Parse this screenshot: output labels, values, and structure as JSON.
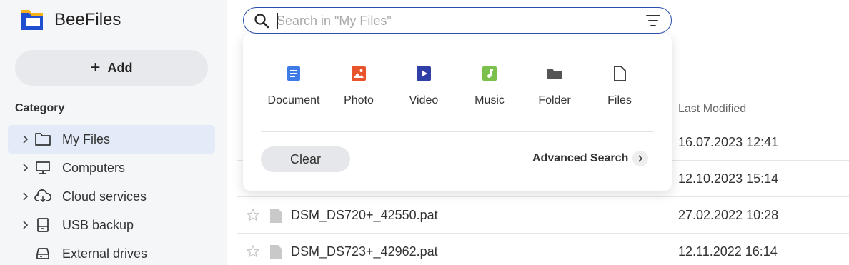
{
  "app": {
    "name": "BeeFiles"
  },
  "sidebar": {
    "add_label": "Add",
    "category_label": "Category",
    "items": [
      {
        "label": "My Files",
        "icon": "folder-icon",
        "active": true,
        "expandable": true
      },
      {
        "label": "Computers",
        "icon": "monitor-icon",
        "active": false,
        "expandable": true
      },
      {
        "label": "Cloud services",
        "icon": "cloud-sync-icon",
        "active": false,
        "expandable": true
      },
      {
        "label": "USB backup",
        "icon": "usb-drive-icon",
        "active": false,
        "expandable": true
      },
      {
        "label": "External drives",
        "icon": "external-drive-icon",
        "active": false,
        "expandable": false
      }
    ]
  },
  "search": {
    "placeholder": "Search in \"My Files\"",
    "value": ""
  },
  "popover": {
    "types": [
      {
        "label": "Document",
        "icon": "document-icon",
        "color": "#3d7be6"
      },
      {
        "label": "Photo",
        "icon": "photo-icon",
        "color": "#e8542c"
      },
      {
        "label": "Video",
        "icon": "video-icon",
        "color": "#2f3fa6"
      },
      {
        "label": "Music",
        "icon": "music-icon",
        "color": "#7cc04c"
      },
      {
        "label": "Folder",
        "icon": "folder-icon",
        "color": "#555555"
      },
      {
        "label": "Files",
        "icon": "file-icon",
        "color": "#555555"
      }
    ],
    "clear_label": "Clear",
    "advanced_label": "Advanced Search"
  },
  "list": {
    "header_modified": "Last Modified",
    "rows": [
      {
        "name": "",
        "modified": "16.07.2023 12:41"
      },
      {
        "name": "",
        "modified": "12.10.2023 15:14"
      },
      {
        "name": "DSM_DS720+_42550.pat",
        "modified": "27.02.2022 10:28"
      },
      {
        "name": "DSM_DS723+_42962.pat",
        "modified": "12.11.2022 16:14"
      }
    ]
  },
  "colors": {
    "accent": "#2b4fa8",
    "sidebar_bg": "#f5f6f8",
    "active_item_bg": "#e3ebf8"
  }
}
